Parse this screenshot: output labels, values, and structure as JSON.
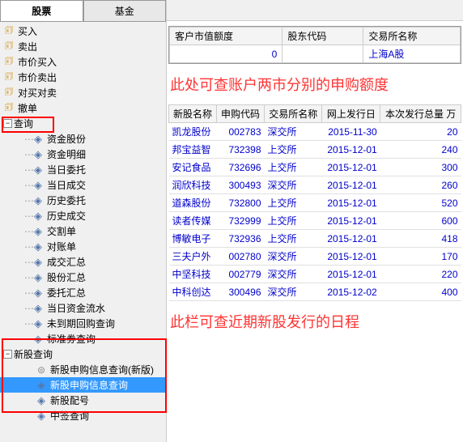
{
  "tabs": {
    "stock": "股票",
    "fund": "基金"
  },
  "top_items": [
    {
      "label": "买入"
    },
    {
      "label": "卖出"
    },
    {
      "label": "市价买入"
    },
    {
      "label": "市价卖出"
    },
    {
      "label": "对买对卖"
    },
    {
      "label": "撤单"
    }
  ],
  "query_label": "查询",
  "query_items": [
    "资金股份",
    "资金明细",
    "当日委托",
    "当日成交",
    "历史委托",
    "历史成交",
    "交割单",
    "对账单",
    "成交汇总",
    "股份汇总",
    "委托汇总",
    "当日资金流水",
    "未到期回购查询",
    "标准券查询"
  ],
  "newstock_label": "新股查询",
  "newstock_items": [
    "新股申购信息查询(新版)",
    "新股申购信息查询",
    "新股配号",
    "中签查询"
  ],
  "quota": {
    "headers": [
      "客户市值额度",
      "股东代码",
      "交易所名称"
    ],
    "row": {
      "value": "0",
      "code": "",
      "exchange": "上海A股"
    }
  },
  "annotation1": "此处可查账户两市分别的申购额度",
  "ipo": {
    "headers": [
      "新股名称",
      "申购代码",
      "交易所名称",
      "网上发行日",
      "本次发行总量 万"
    ],
    "rows": [
      {
        "name": "凯龙股份",
        "code": "002783",
        "ex": "深交所",
        "date": "2015-11-30",
        "vol": "20"
      },
      {
        "name": "邦宝益智",
        "code": "732398",
        "ex": "上交所",
        "date": "2015-12-01",
        "vol": "240"
      },
      {
        "name": "安记食品",
        "code": "732696",
        "ex": "上交所",
        "date": "2015-12-01",
        "vol": "300"
      },
      {
        "name": "润欣科技",
        "code": "300493",
        "ex": "深交所",
        "date": "2015-12-01",
        "vol": "260"
      },
      {
        "name": "道森股份",
        "code": "732800",
        "ex": "上交所",
        "date": "2015-12-01",
        "vol": "520"
      },
      {
        "name": "读者传媒",
        "code": "732999",
        "ex": "上交所",
        "date": "2015-12-01",
        "vol": "600"
      },
      {
        "name": "博敏电子",
        "code": "732936",
        "ex": "上交所",
        "date": "2015-12-01",
        "vol": "418"
      },
      {
        "name": "三夫户外",
        "code": "002780",
        "ex": "深交所",
        "date": "2015-12-01",
        "vol": "170"
      },
      {
        "name": "中坚科技",
        "code": "002779",
        "ex": "深交所",
        "date": "2015-12-01",
        "vol": "220"
      },
      {
        "name": "中科创达",
        "code": "300496",
        "ex": "深交所",
        "date": "2015-12-02",
        "vol": "400"
      }
    ]
  },
  "annotation2": "此栏可查近期新股发行的日程"
}
